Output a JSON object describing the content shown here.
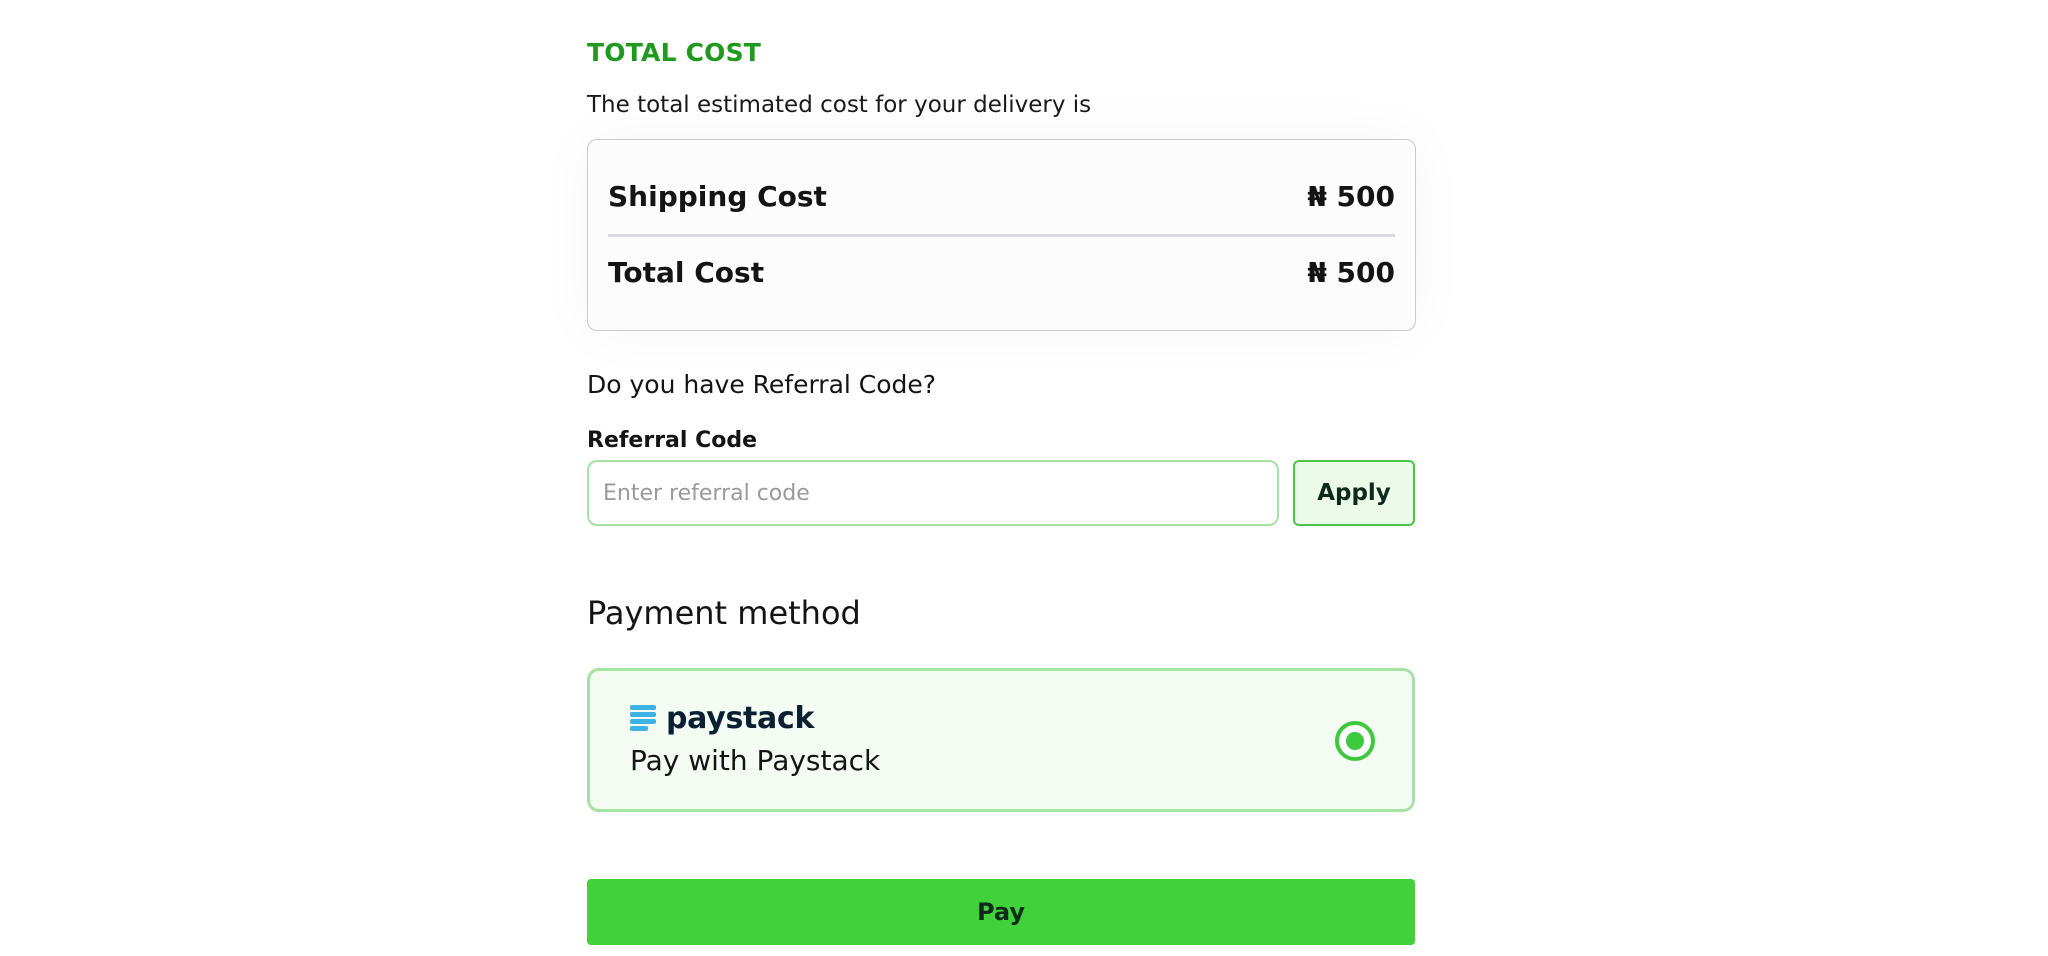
{
  "summary": {
    "title": "TOTAL COST",
    "subtitle": "The total estimated cost for your delivery is",
    "rows": [
      {
        "label": "Shipping Cost",
        "value": "₦ 500"
      },
      {
        "label": "Total Cost",
        "value": "₦ 500"
      }
    ]
  },
  "referral": {
    "question": "Do you have Referral Code?",
    "label": "Referral Code",
    "placeholder": "Enter referral code",
    "value": "",
    "apply_label": "Apply"
  },
  "payment": {
    "title": "Payment method",
    "option": {
      "brand": "paystack",
      "description": "Pay with Paystack",
      "selected": true,
      "icon": "paystack-logo-icon"
    }
  },
  "actions": {
    "pay_label": "Pay"
  },
  "colors": {
    "accent": "#41d13b",
    "title_green": "#1f9a1f",
    "paystack_blue": "#3bb3e4",
    "paystack_navy": "#0b1f33"
  }
}
